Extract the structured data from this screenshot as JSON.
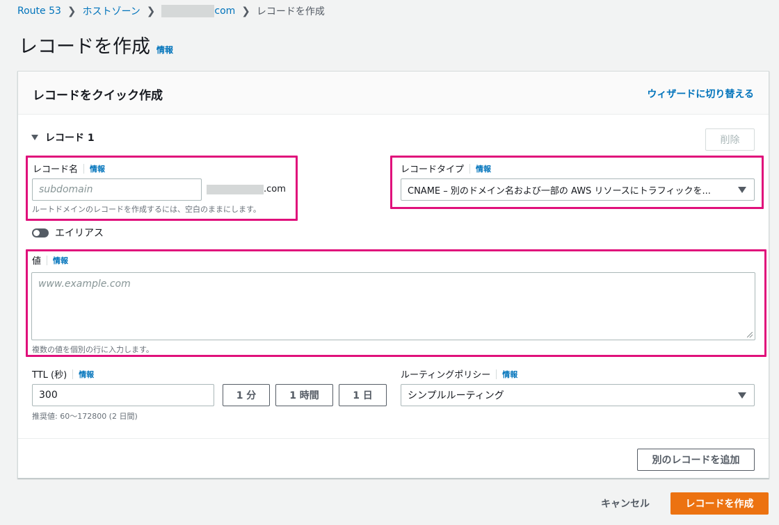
{
  "breadcrumb": {
    "items": [
      "Route 53",
      "ホストゾーン",
      "com",
      "レコードを作成"
    ]
  },
  "page": {
    "title": "レコードを作成",
    "info": "情報"
  },
  "panel": {
    "title": "レコードをクイック作成",
    "wizard_link": "ウィザードに切り替える",
    "record_section": "レコード 1",
    "delete_button": "削除",
    "record_name": {
      "label": "レコード名",
      "info": "情報",
      "placeholder": "subdomain",
      "domain_suffix": ".com",
      "hint": "ルートドメインのレコードを作成するには、空白のままにします。"
    },
    "record_type": {
      "label": "レコードタイプ",
      "info": "情報",
      "selected": "CNAME – 別のドメイン名および一部の AWS リソースにトラフィックを..."
    },
    "alias": {
      "label": "エイリアス",
      "enabled": false
    },
    "value": {
      "label": "値",
      "info": "情報",
      "placeholder": "www.example.com",
      "hint": "複数の値を個別の行に入力します。"
    },
    "ttl": {
      "label": "TTL (秒)",
      "info": "情報",
      "value": "300",
      "btn_1min": "1 分",
      "btn_1hour": "1 時間",
      "btn_1day": "1 日",
      "hint": "推奨値: 60～172800 (2 日間)"
    },
    "routing": {
      "label": "ルーティングポリシー",
      "info": "情報",
      "selected": "シンプルルーティング"
    },
    "add_record_button": "別のレコードを追加"
  },
  "actions": {
    "cancel": "キャンセル",
    "create": "レコードを作成"
  },
  "colors": {
    "link": "#0073bb",
    "primary": "#ec7211",
    "highlight": "#e0107b"
  },
  "icons": [
    "chevron-right-icon",
    "caret-down-icon",
    "triangle-down-icon",
    "resize-grip-icon"
  ]
}
